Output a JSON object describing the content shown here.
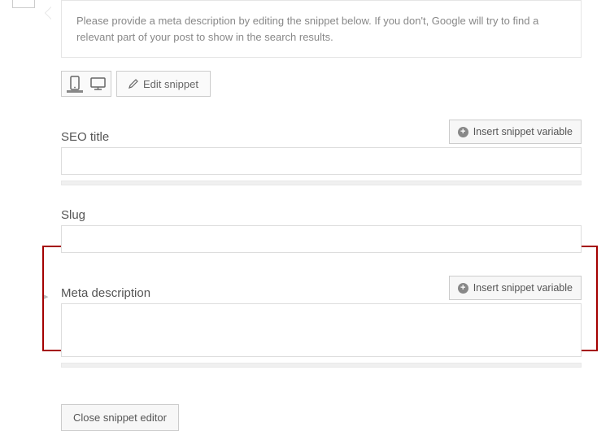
{
  "hint": "Please provide a meta description by editing the snippet below. If you don't, Google will try to find a relevant part of your post to show in the search results.",
  "editSnippet": "Edit snippet",
  "seoTitle": {
    "label": "SEO title",
    "insertBtn": "Insert snippet variable"
  },
  "slug": {
    "label": "Slug"
  },
  "metaDescription": {
    "label": "Meta description",
    "insertBtn": "Insert snippet variable"
  },
  "closeBtn": "Close snippet editor"
}
